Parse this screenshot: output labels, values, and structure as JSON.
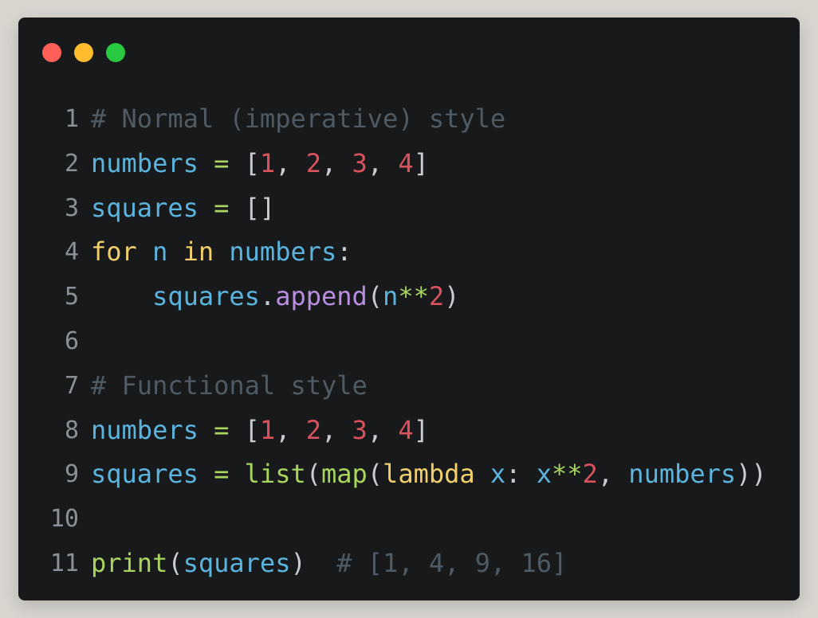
{
  "window": {
    "controls": [
      "close",
      "minimize",
      "maximize"
    ]
  },
  "editor": {
    "lines": [
      {
        "number": "1",
        "tokens": [
          {
            "t": "# Normal (imperative) style",
            "k": "comment"
          }
        ]
      },
      {
        "number": "2",
        "tokens": [
          {
            "t": "numbers",
            "k": "var"
          },
          {
            "t": " ",
            "k": "punc"
          },
          {
            "t": "=",
            "k": "op"
          },
          {
            "t": " [",
            "k": "punc"
          },
          {
            "t": "1",
            "k": "num"
          },
          {
            "t": ", ",
            "k": "punc"
          },
          {
            "t": "2",
            "k": "num"
          },
          {
            "t": ", ",
            "k": "punc"
          },
          {
            "t": "3",
            "k": "num"
          },
          {
            "t": ", ",
            "k": "punc"
          },
          {
            "t": "4",
            "k": "num"
          },
          {
            "t": "]",
            "k": "punc"
          }
        ]
      },
      {
        "number": "3",
        "tokens": [
          {
            "t": "squares",
            "k": "var"
          },
          {
            "t": " ",
            "k": "punc"
          },
          {
            "t": "=",
            "k": "op"
          },
          {
            "t": " []",
            "k": "punc"
          }
        ]
      },
      {
        "number": "4",
        "tokens": [
          {
            "t": "for",
            "k": "kw"
          },
          {
            "t": " ",
            "k": "punc"
          },
          {
            "t": "n",
            "k": "var"
          },
          {
            "t": " ",
            "k": "punc"
          },
          {
            "t": "in",
            "k": "kw"
          },
          {
            "t": " ",
            "k": "punc"
          },
          {
            "t": "numbers",
            "k": "var"
          },
          {
            "t": ":",
            "k": "punc"
          }
        ]
      },
      {
        "number": "5",
        "tokens": [
          {
            "t": "    ",
            "k": "punc"
          },
          {
            "t": "squares",
            "k": "var"
          },
          {
            "t": ".",
            "k": "punc"
          },
          {
            "t": "append",
            "k": "method"
          },
          {
            "t": "(",
            "k": "punc"
          },
          {
            "t": "n",
            "k": "var"
          },
          {
            "t": "**",
            "k": "op"
          },
          {
            "t": "2",
            "k": "num"
          },
          {
            "t": ")",
            "k": "punc"
          }
        ]
      },
      {
        "number": "6",
        "tokens": []
      },
      {
        "number": "7",
        "tokens": [
          {
            "t": "# Functional style",
            "k": "comment"
          }
        ]
      },
      {
        "number": "8",
        "tokens": [
          {
            "t": "numbers",
            "k": "var"
          },
          {
            "t": " ",
            "k": "punc"
          },
          {
            "t": "=",
            "k": "op"
          },
          {
            "t": " [",
            "k": "punc"
          },
          {
            "t": "1",
            "k": "num"
          },
          {
            "t": ", ",
            "k": "punc"
          },
          {
            "t": "2",
            "k": "num"
          },
          {
            "t": ", ",
            "k": "punc"
          },
          {
            "t": "3",
            "k": "num"
          },
          {
            "t": ", ",
            "k": "punc"
          },
          {
            "t": "4",
            "k": "num"
          },
          {
            "t": "]",
            "k": "punc"
          }
        ]
      },
      {
        "number": "9",
        "tokens": [
          {
            "t": "squares",
            "k": "var"
          },
          {
            "t": " ",
            "k": "punc"
          },
          {
            "t": "=",
            "k": "op"
          },
          {
            "t": " ",
            "k": "punc"
          },
          {
            "t": "list",
            "k": "fn"
          },
          {
            "t": "(",
            "k": "punc"
          },
          {
            "t": "map",
            "k": "fn"
          },
          {
            "t": "(",
            "k": "punc"
          },
          {
            "t": "lambda",
            "k": "kw"
          },
          {
            "t": " ",
            "k": "punc"
          },
          {
            "t": "x",
            "k": "var"
          },
          {
            "t": ": ",
            "k": "punc"
          },
          {
            "t": "x",
            "k": "var"
          },
          {
            "t": "**",
            "k": "op"
          },
          {
            "t": "2",
            "k": "num"
          },
          {
            "t": ", ",
            "k": "punc"
          },
          {
            "t": "numbers",
            "k": "var"
          },
          {
            "t": "))",
            "k": "punc"
          }
        ]
      },
      {
        "number": "10",
        "tokens": []
      },
      {
        "number": "11",
        "tokens": [
          {
            "t": "print",
            "k": "fn"
          },
          {
            "t": "(",
            "k": "punc"
          },
          {
            "t": "squares",
            "k": "var"
          },
          {
            "t": ")",
            "k": "punc"
          },
          {
            "t": "  ",
            "k": "punc"
          },
          {
            "t": "# [1, 4, 9, 16]",
            "k": "comment"
          }
        ]
      }
    ]
  },
  "colors": {
    "background": "#d8d6cf",
    "window": "#18191b",
    "close": "#ff5f57",
    "minimize": "#febc2e",
    "maximize": "#28c840",
    "comment": "#4f5a62",
    "variable": "#5ab4dd",
    "operator": "#a9d45e",
    "number": "#d9525d",
    "keyword": "#f1cf6b",
    "builtin": "#a9d45e",
    "method": "#b98ddf",
    "punctuation": "#c9ccd1",
    "line_number": "#8a9095"
  }
}
